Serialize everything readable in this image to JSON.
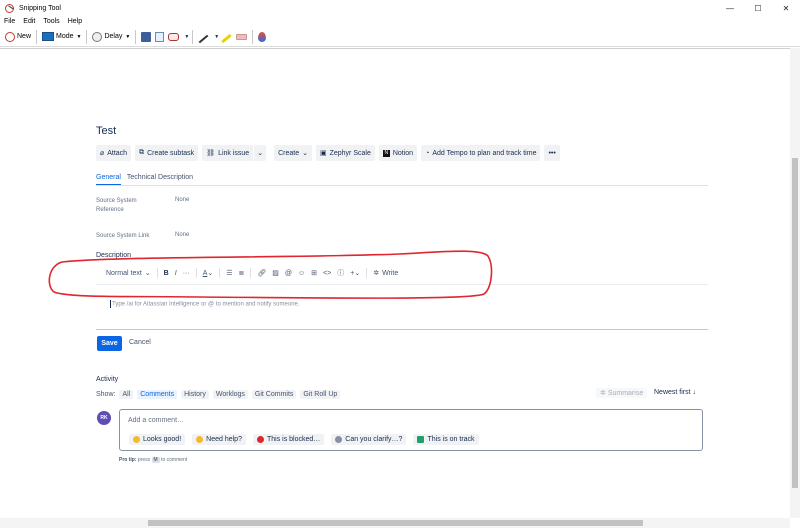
{
  "window": {
    "title": "Snipping Tool",
    "controls": {
      "minimize": "—",
      "maximize": "☐",
      "close": "✕"
    }
  },
  "menu": [
    "File",
    "Edit",
    "Tools",
    "Help"
  ],
  "toolbar": {
    "new_label": "New",
    "mode_label": "Mode",
    "delay_label": "Delay",
    "dropdown_glyph": "▼"
  },
  "issue": {
    "title": "Test",
    "actions": {
      "attach": "Attach",
      "create_subtask": "Create subtask",
      "link_issue": "Link issue",
      "create": "Create",
      "zephyr": "Zephyr Scale",
      "notion": "Notion",
      "tempo": "Add Tempo to plan and track time",
      "more": "•••"
    },
    "tabs": [
      "General",
      "Technical Description"
    ],
    "fields": {
      "source_system_reference_label": "Source System Reference",
      "source_system_reference_value": "None",
      "source_system_link_label": "Source System Link",
      "source_system_link_value": "None"
    },
    "description": {
      "label": "Description",
      "text_style": "Normal text",
      "write_label": "Write",
      "placeholder": "Type /ai for Atlassian Intelligence or @ to mention and notify someone."
    },
    "save": "Save",
    "cancel": "Cancel"
  },
  "activity": {
    "title": "Activity",
    "show_label": "Show:",
    "filters": [
      "All",
      "Comments",
      "History",
      "Worklogs",
      "Git Commits",
      "Git Roll Up"
    ],
    "active_filter": "Comments",
    "summarise": "Summarise",
    "sort": "Newest first ↓",
    "avatar_initials": "RK",
    "comment_placeholder": "Add a comment…",
    "quick_replies": [
      "Looks good!",
      "Need help?",
      "This is blocked…",
      "Can you clarify…?",
      "This is on track"
    ],
    "pro_tip": {
      "prefix": "Pro tip:",
      "press": "press",
      "key": "M",
      "suffix": "to comment"
    }
  },
  "colors": {
    "jira_blue": "#0c66e4",
    "annotation_red": "#e0262e",
    "avatar_purple": "#5e4db2"
  }
}
